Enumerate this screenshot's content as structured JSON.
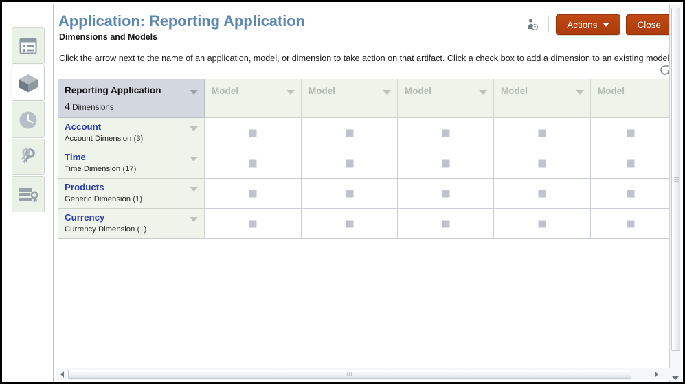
{
  "window": {
    "title": "Application: Reporting Application",
    "subtitle": "Dimensions and Models",
    "instructions": "Click the arrow next to the name of an application, model, or dimension to take action on that artifact. Click a check box to add a dimension to an existing model."
  },
  "header": {
    "user_help_icon": "user-help-icon",
    "actions_label": "Actions",
    "close_label": "Close",
    "refresh_icon": "refresh-icon"
  },
  "sidebar": {
    "items": [
      {
        "name": "sidebar-item-forms",
        "icon": "list-form-icon",
        "active": false
      },
      {
        "name": "sidebar-item-cube",
        "icon": "cube-icon",
        "active": true
      },
      {
        "name": "sidebar-item-jobs",
        "icon": "clock-icon",
        "active": false
      },
      {
        "name": "sidebar-item-access",
        "icon": "keys-icon",
        "active": false
      },
      {
        "name": "sidebar-item-database-security",
        "icon": "database-key-icon",
        "active": false
      }
    ]
  },
  "grid": {
    "app_header": {
      "name": "Reporting Application",
      "count": "4",
      "count_label": "Dimensions",
      "caret": "chevron-down-icon"
    },
    "model_columns": [
      {
        "label": "Model",
        "caret": "chevron-down-icon"
      },
      {
        "label": "Model",
        "caret": "chevron-down-icon"
      },
      {
        "label": "Model",
        "caret": "chevron-down-icon"
      },
      {
        "label": "Model",
        "caret": "chevron-down-icon"
      },
      {
        "label": "Model",
        "caret": "chevron-down-icon"
      }
    ],
    "rows": [
      {
        "name": "Account",
        "type": "Account Dimension",
        "count": "(3)",
        "caret": "chevron-down-icon"
      },
      {
        "name": "Time",
        "type": "Time Dimension",
        "count": "(17)",
        "caret": "chevron-down-icon"
      },
      {
        "name": "Products",
        "type": "Generic Dimension",
        "count": "(1)",
        "caret": "chevron-down-icon"
      },
      {
        "name": "Currency",
        "type": "Currency Dimension",
        "count": "(1)",
        "caret": "chevron-down-icon"
      }
    ]
  },
  "scrollbars": {
    "vertical": {
      "name": "vertical-scrollbar"
    },
    "horizontal": {
      "name": "horizontal-scrollbar"
    }
  },
  "colors": {
    "title_blue": "#5b87b1",
    "button_orange": "#b5410f",
    "app_header_bg": "#d3d8e0",
    "row_bg": "#eef4ea",
    "dim_name_blue": "#2b3fae",
    "checkbox_gray": "#bfc3ce"
  }
}
